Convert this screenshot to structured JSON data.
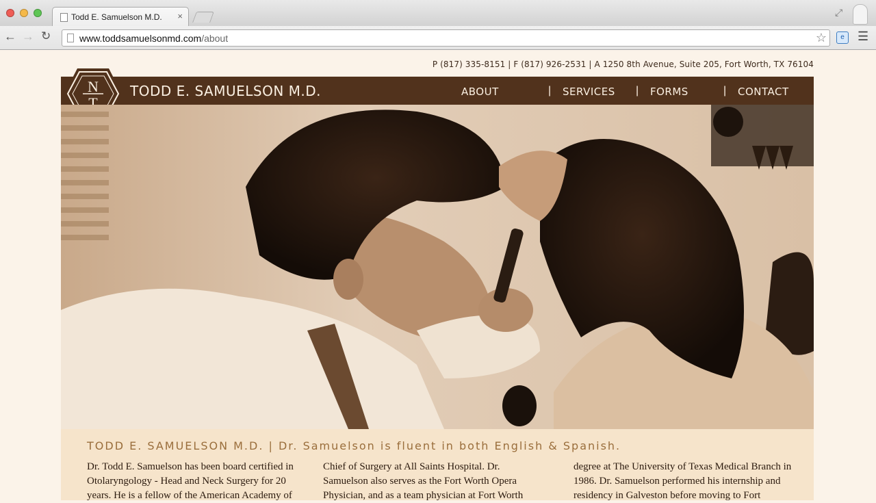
{
  "browser": {
    "tab_title": "Todd E. Samuelson M.D.",
    "tab_close": "×",
    "url_host": "www.toddsamuelsonmd.com",
    "url_path": "/about"
  },
  "site": {
    "contact_line": "P (817) 335-8151 | F (817) 926-2531 | A 1250 8th Avenue, Suite 205, Fort Worth, TX 76104",
    "title": "TODD E. SAMUELSON M.D.",
    "logo_letters": {
      "top": "N",
      "bottom": "T"
    },
    "nav": {
      "about": "ABOUT",
      "services": "SERVICES",
      "forms": "FORMS",
      "contact": "CONTACT",
      "separator": "|"
    }
  },
  "main": {
    "headline": "TODD E. SAMUELSON M.D.  |  Dr. Samuelson is fluent in both English & Spanish.",
    "col1": "Dr. Todd E. Samuelson has been board certified in Otolaryngology - Head and Neck Surgery for 20 years. He is a fellow of the American Academy of",
    "col2": "Chief of Surgery at All Saints Hospital. Dr. Samuelson also serves as the Fort Worth Opera Physician, and as a team physician at Fort Worth",
    "col3": "degree at The University of Texas Medical Branch in 1986. Dr. Samuelson performed his internship and residency in Galveston before moving to Fort"
  },
  "colors": {
    "brand_brown": "#51321c",
    "page_bg": "#fbf3e9",
    "band_bg": "#f6e4cb",
    "headline": "#9a6e3c"
  }
}
